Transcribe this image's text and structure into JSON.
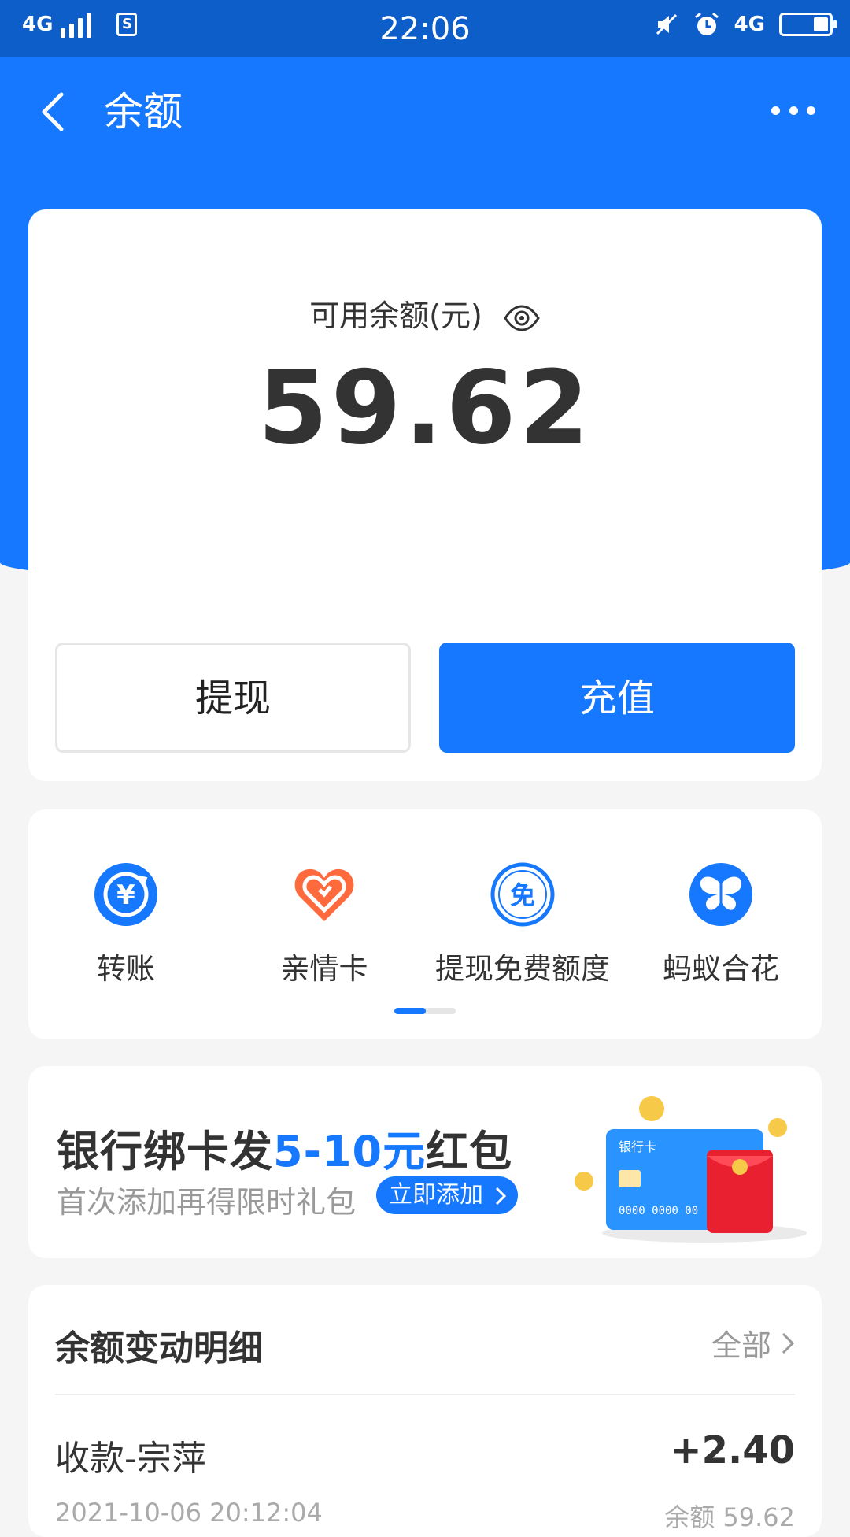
{
  "status_bar": {
    "network": "4G",
    "time": "22:06",
    "network_right": "4G",
    "sim_label": "S"
  },
  "nav": {
    "title": "余额"
  },
  "balance": {
    "label": "可用余额(元)",
    "amount": "59.62",
    "withdraw_label": "提现",
    "recharge_label": "充值"
  },
  "services": [
    {
      "label": "转账",
      "icon": "transfer-icon"
    },
    {
      "label": "亲情卡",
      "icon": "family-card-icon"
    },
    {
      "label": "提现免费额度",
      "icon": "free-withdraw-icon"
    },
    {
      "label": "蚂蚁合花",
      "icon": "butterfly-icon"
    }
  ],
  "services_glyphs": {
    "transfer": "¥",
    "free": "免"
  },
  "promo": {
    "title_prefix": "银行绑卡发",
    "title_highlight": "5-10元",
    "title_suffix": "红包",
    "subtitle": "首次添加再得限时礼包",
    "button_label": "立即添加",
    "card_label": "银行卡",
    "card_numbers": "0000   0000   00"
  },
  "details": {
    "title": "余额变动明细",
    "all_label": "全部",
    "transactions": [
      {
        "name": "收款-宗萍",
        "amount": "+2.40",
        "time": "2021-10-06 20:12:04",
        "balance": "余额 59.62"
      }
    ]
  },
  "colors": {
    "brand": "#1677ff",
    "status_bar": "#0d5ec9",
    "background": "#f5f5f5"
  }
}
